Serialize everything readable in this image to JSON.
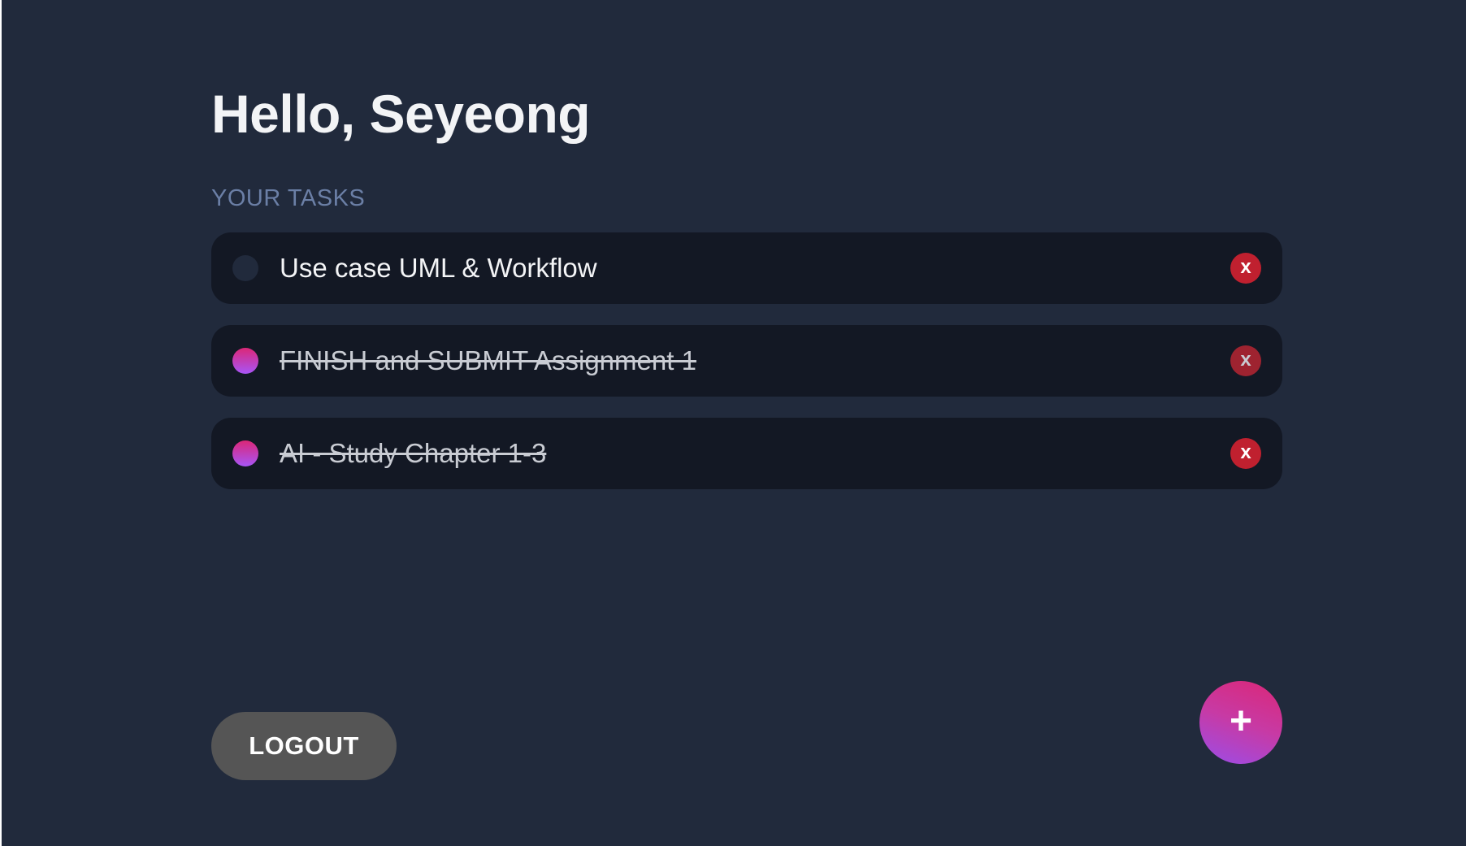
{
  "header": {
    "greeting": "Hello, Seyeong"
  },
  "tasks_section": {
    "label": "YOUR TASKS",
    "items": [
      {
        "text": "Use case UML & Workflow",
        "completed": false,
        "delete_label": "x"
      },
      {
        "text": "FINISH and SUBMIT Assignment 1",
        "completed": true,
        "delete_label": "x"
      },
      {
        "text": "AI - Study Chapter 1-3",
        "completed": true,
        "delete_label": "x"
      }
    ]
  },
  "footer": {
    "logout_label": "LOGOUT",
    "add_label": "+"
  },
  "colors": {
    "background": "#212a3c",
    "card": "#131824",
    "accent_start": "#db2777",
    "accent_end": "#a855f7",
    "delete": "#c0202f",
    "logout": "#555555"
  },
  "icons": {
    "check": "circle-check-icon",
    "delete": "delete-x-icon",
    "add": "plus-icon"
  }
}
